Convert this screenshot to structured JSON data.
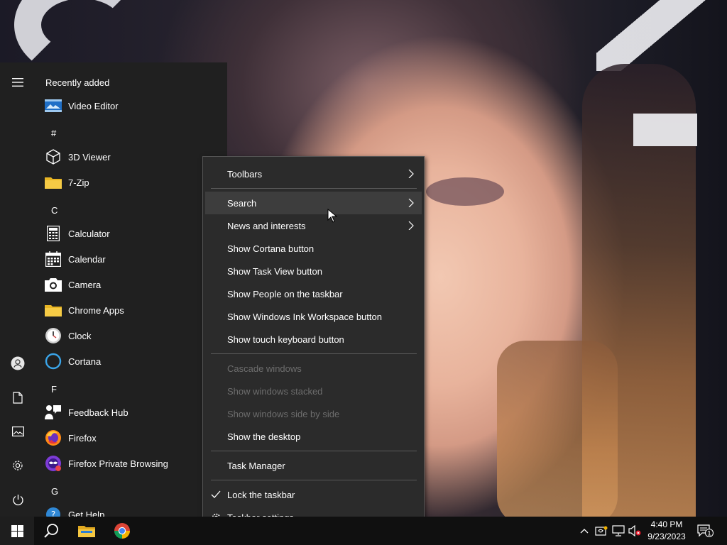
{
  "start_menu": {
    "header": "Recently added",
    "sections": {
      "hash": "#",
      "c": "C",
      "f": "F",
      "g": "G"
    },
    "apps": [
      {
        "label": "Video Editor",
        "icon": "video-editor-icon"
      },
      {
        "label": "3D Viewer",
        "icon": "cube-icon"
      },
      {
        "label": "7-Zip",
        "icon": "folder-icon"
      },
      {
        "label": "Calculator",
        "icon": "calculator-icon"
      },
      {
        "label": "Calendar",
        "icon": "calendar-icon"
      },
      {
        "label": "Camera",
        "icon": "camera-icon"
      },
      {
        "label": "Chrome Apps",
        "icon": "folder-icon"
      },
      {
        "label": "Clock",
        "icon": "clock-icon"
      },
      {
        "label": "Cortana",
        "icon": "cortana-icon"
      },
      {
        "label": "Feedback Hub",
        "icon": "feedback-hub-icon"
      },
      {
        "label": "Firefox",
        "icon": "firefox-icon"
      },
      {
        "label": "Firefox Private Browsing",
        "icon": "firefox-private-icon"
      },
      {
        "label": "Get Help",
        "icon": "get-help-icon"
      }
    ]
  },
  "context_menu": {
    "items": [
      {
        "label": "Toolbars",
        "submenu": true,
        "disabled": false
      },
      {
        "label": "Search",
        "submenu": true,
        "disabled": false,
        "hover": true
      },
      {
        "label": "News and interests",
        "submenu": true,
        "disabled": false
      },
      {
        "label": "Show Cortana button",
        "disabled": false
      },
      {
        "label": "Show Task View button",
        "disabled": false
      },
      {
        "label": "Show People on the taskbar",
        "disabled": false
      },
      {
        "label": "Show Windows Ink Workspace button",
        "disabled": false
      },
      {
        "label": "Show touch keyboard button",
        "disabled": false
      },
      {
        "label": "Cascade windows",
        "disabled": true
      },
      {
        "label": "Show windows stacked",
        "disabled": true
      },
      {
        "label": "Show windows side by side",
        "disabled": true
      },
      {
        "label": "Show the desktop",
        "disabled": false
      },
      {
        "label": "Task Manager",
        "disabled": false
      },
      {
        "label": "Lock the taskbar",
        "checked": true,
        "disabled": false
      },
      {
        "label": "Taskbar settings",
        "icon": "gear-icon",
        "disabled": false
      }
    ]
  },
  "taskbar": {
    "time": "4:40 PM",
    "date": "9/23/2023",
    "notification_count": "1"
  },
  "colors": {
    "menu_bg": "#202020",
    "context_bg": "#2b2b2b",
    "taskbar_bg": "#101010",
    "accent_blue": "#0078d7"
  }
}
